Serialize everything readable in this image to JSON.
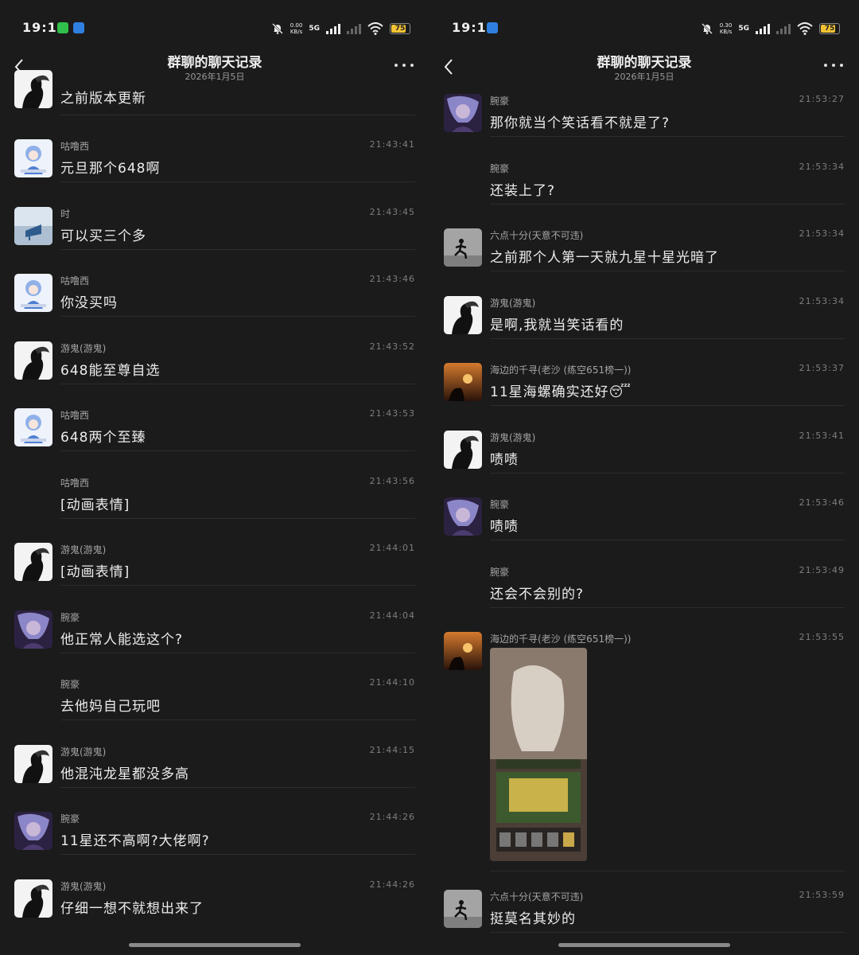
{
  "status": {
    "time": "19:13",
    "speed_left": [
      "0.00",
      "KB/s"
    ],
    "speed_right": [
      "0.30",
      "KB/s"
    ],
    "network": "5G",
    "battery": "75",
    "battery_level": 0.75
  },
  "header": {
    "title": "群聊的聊天记录",
    "date": "2026年1月5日"
  },
  "left_messages": [
    {
      "sender": "",
      "time": "",
      "text": "之前版本更新",
      "avatar": "silhouette"
    },
    {
      "sender": "咕噜西",
      "time": "21:43:41",
      "text": "元旦那个648啊",
      "avatar": "anime-blue"
    },
    {
      "sender": "时",
      "time": "21:43:45",
      "text": "可以买三个多",
      "avatar": "piano"
    },
    {
      "sender": "咕噜西",
      "time": "21:43:46",
      "text": "你没买吗",
      "avatar": "anime-blue"
    },
    {
      "sender": "游鬼(游鬼)",
      "time": "21:43:52",
      "text": "648能至尊自选",
      "avatar": "silhouette"
    },
    {
      "sender": "咕噜西",
      "time": "21:43:53",
      "text": "648两个至臻",
      "avatar": "anime-blue"
    },
    {
      "sender": "咕噜西",
      "time": "21:43:56",
      "text": "[动画表情]",
      "avatar": ""
    },
    {
      "sender": "游鬼(游鬼)",
      "time": "21:44:01",
      "text": "[动画表情]",
      "avatar": "silhouette"
    },
    {
      "sender": "腕豪",
      "time": "21:44:04",
      "text": "他正常人能选这个?",
      "avatar": "purple"
    },
    {
      "sender": "腕豪",
      "time": "21:44:10",
      "text": "去他妈自己玩吧",
      "avatar": ""
    },
    {
      "sender": "游鬼(游鬼)",
      "time": "21:44:15",
      "text": "他混沌龙星都没多高",
      "avatar": "silhouette"
    },
    {
      "sender": "腕豪",
      "time": "21:44:26",
      "text": "11星还不高啊?大佬啊?",
      "avatar": "purple"
    },
    {
      "sender": "游鬼(游鬼)",
      "time": "21:44:26",
      "text": "仔细一想不就想出来了",
      "avatar": "silhouette"
    }
  ],
  "right_messages": [
    {
      "sender": "腕豪",
      "time": "21:53:27",
      "text": "那你就当个笑话看不就是了?",
      "avatar": "purple"
    },
    {
      "sender": "腕豪",
      "time": "21:53:34",
      "text": "还装上了?",
      "avatar": ""
    },
    {
      "sender": "六点十分(天意不可违)",
      "time": "21:53:34",
      "text": "之前那个人第一天就九星十星光暗了",
      "avatar": "runner"
    },
    {
      "sender": "游鬼(游鬼)",
      "time": "21:53:34",
      "text": "是啊,我就当笑话看的",
      "avatar": "silhouette"
    },
    {
      "sender": "海边的千寻(老沙 (练空651榜一))",
      "time": "21:53:37",
      "text": "11星海螺确实还好😴",
      "avatar": "sunset"
    },
    {
      "sender": "游鬼(游鬼)",
      "time": "21:53:41",
      "text": "啧啧",
      "avatar": "silhouette"
    },
    {
      "sender": "腕豪",
      "time": "21:53:46",
      "text": "啧啧",
      "avatar": "purple"
    },
    {
      "sender": "腕豪",
      "time": "21:53:49",
      "text": "还会不会别的?",
      "avatar": ""
    },
    {
      "sender": "海边的千寻(老沙 (练空651榜一))",
      "time": "21:53:55",
      "text": "",
      "avatar": "sunset"
    },
    {
      "sender": "六点十分(天意不可违)",
      "time": "21:53:59",
      "text": "挺莫名其妙的",
      "avatar": "runner"
    }
  ]
}
